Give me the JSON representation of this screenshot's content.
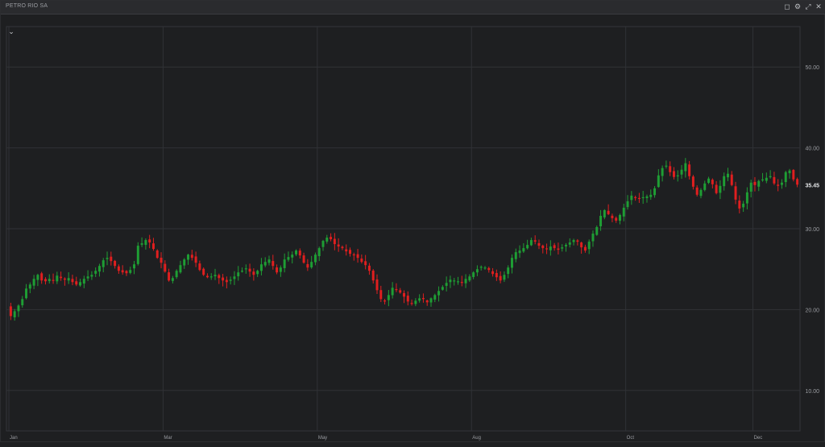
{
  "window": {
    "title": "PETRO RIO SA",
    "buttons": [
      {
        "name": "restore-button",
        "glyph": "◻"
      },
      {
        "name": "settings-button",
        "glyph": "⚙"
      },
      {
        "name": "expand-button",
        "glyph": "⤢"
      },
      {
        "name": "close-button",
        "glyph": "✕"
      }
    ]
  },
  "chart_menu_glyph": "⌄",
  "colors": {
    "up": "#1e9e34",
    "down": "#e01f1f",
    "grid": "#303236",
    "text": "#9a9ca1",
    "background": "#1e1f21"
  },
  "chart_data": {
    "type": "candlestick",
    "x_tick_labels": [
      "Jan",
      "Mar",
      "May",
      "Aug",
      "Oct",
      "Dec"
    ],
    "x_tick_positions": [
      0,
      40,
      80,
      120,
      160,
      193
    ],
    "y_ticks": [
      10,
      20,
      30,
      40,
      50
    ],
    "y_tick_labels": [
      "10.00",
      "20.00",
      "30.00",
      "40.00",
      "50.00"
    ],
    "ylim": [
      5,
      55
    ],
    "last_price": 35.45,
    "last_price_label": "35.45",
    "grid": true,
    "closes": [
      19.2,
      19.8,
      20.5,
      21.3,
      22.6,
      23.1,
      23.8,
      24.3,
      23.6,
      23.5,
      23.8,
      23.6,
      24.2,
      23.9,
      23.7,
      23.9,
      23.4,
      23.1,
      23.4,
      23.8,
      24.1,
      24.3,
      24.8,
      25.4,
      26.1,
      26.4,
      26.0,
      25.4,
      24.8,
      24.6,
      24.5,
      24.9,
      25.6,
      27.9,
      28.2,
      28.6,
      28.3,
      27.5,
      26.4,
      25.8,
      24.7,
      23.6,
      23.9,
      24.8,
      25.5,
      26.2,
      26.8,
      26.4,
      25.8,
      24.9,
      24.3,
      24.0,
      24.1,
      24.3,
      23.9,
      23.6,
      23.4,
      23.7,
      24.1,
      24.6,
      24.8,
      25.1,
      24.7,
      24.3,
      24.8,
      25.6,
      25.9,
      26.2,
      25.4,
      24.6,
      25.2,
      26.2,
      26.5,
      26.8,
      27.3,
      26.7,
      25.8,
      25.2,
      25.9,
      26.8,
      27.6,
      28.5,
      28.9,
      28.7,
      28.1,
      27.8,
      27.6,
      27.2,
      26.9,
      26.8,
      26.4,
      25.9,
      25.5,
      24.8,
      23.6,
      22.4,
      21.3,
      21.0,
      21.8,
      22.7,
      22.5,
      22.1,
      21.6,
      21.0,
      20.7,
      21.1,
      21.4,
      21.3,
      20.9,
      21.4,
      21.8,
      22.3,
      22.8,
      23.3,
      23.7,
      23.6,
      23.5,
      23.4,
      23.8,
      24.1,
      24.6,
      25.0,
      25.3,
      25.2,
      24.9,
      24.4,
      24.0,
      23.6,
      24.3,
      25.2,
      26.4,
      27.1,
      27.3,
      27.6,
      28.0,
      28.6,
      28.4,
      27.9,
      27.6,
      27.5,
      27.8,
      27.6,
      27.4,
      27.7,
      28.0,
      28.3,
      28.6,
      28.4,
      27.7,
      27.3,
      28.4,
      29.4,
      30.2,
      31.6,
      32.3,
      31.8,
      31.3,
      31.0,
      31.7,
      32.6,
      33.4,
      34.1,
      33.8,
      33.7,
      33.9,
      34.0,
      34.2,
      35.0,
      36.6,
      37.5,
      37.8,
      37.0,
      36.4,
      36.6,
      37.3,
      38.1,
      36.5,
      35.2,
      34.2,
      34.8,
      35.6,
      36.2,
      35.5,
      34.4,
      35.3,
      36.5,
      36.8,
      35.4,
      33.6,
      32.5,
      33.1,
      34.5,
      35.7,
      35.4,
      35.9,
      36.1,
      36.3,
      36.5,
      35.6,
      35.3,
      35.7,
      37.0,
      37.2,
      36.1,
      35.45
    ]
  }
}
